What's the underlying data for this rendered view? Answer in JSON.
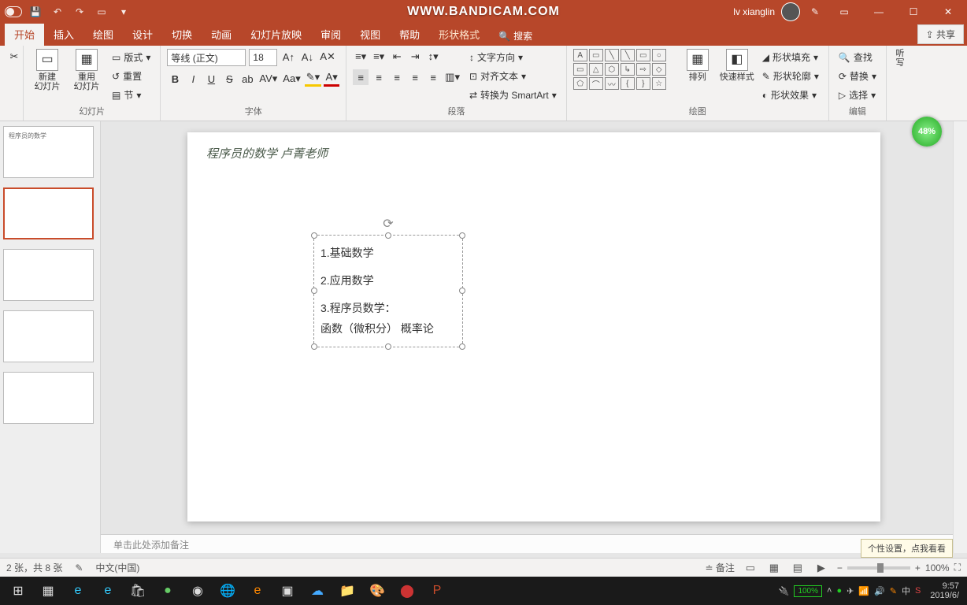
{
  "watermark": "WWW.BANDICAM.COM",
  "user": "lv xianglin",
  "tabs": [
    "开始",
    "插入",
    "绘图",
    "设计",
    "切换",
    "动画",
    "幻灯片放映",
    "审阅",
    "视图",
    "帮助",
    "形状格式"
  ],
  "search": {
    "icon": "search-icon",
    "placeholder": "搜索"
  },
  "share": "共享",
  "ribbon": {
    "slides": {
      "new": "新建\n幻灯片",
      "reuse": "重用\n幻灯片",
      "layout": "版式",
      "reset": "重置",
      "section": "节",
      "label": "幻灯片"
    },
    "font": {
      "name": "等线 (正文)",
      "size": "18",
      "bold": "B",
      "italic": "I",
      "underline": "U",
      "strike": "S",
      "label": "字体"
    },
    "paragraph": {
      "textdir": "文字方向",
      "align": "对齐文本",
      "smartart": "转换为 SmartArt",
      "label": "段落"
    },
    "drawing": {
      "arrange": "排列",
      "quickstyle": "快速样式",
      "fill": "形状填充",
      "outline": "形状轮廓",
      "effects": "形状效果",
      "label": "绘图"
    },
    "editing": {
      "find": "查找",
      "replace": "替换",
      "select": "选择",
      "label": "编辑"
    },
    "voice": {
      "label": "听写"
    }
  },
  "slide": {
    "header": "程序员的数学  卢菁老师",
    "lines": [
      "1.基础数学",
      "2.应用数学",
      "3.程序员数学：",
      "函数（微积分）  概率论"
    ]
  },
  "thumbs": {
    "t1": "程序员的数学",
    "active_index": 1
  },
  "notes_placeholder": "单击此处添加备注",
  "status": {
    "page": "2 张，共 8 张",
    "lang": "中文(中国)",
    "notes": "备注",
    "zoom": "100%"
  },
  "tooltip": "个性设置，点我看看",
  "badge": "48%",
  "taskbar": {
    "battery": "100%",
    "time": "9:57",
    "date": "2019/6/"
  },
  "ime": [
    "中",
    "S"
  ]
}
